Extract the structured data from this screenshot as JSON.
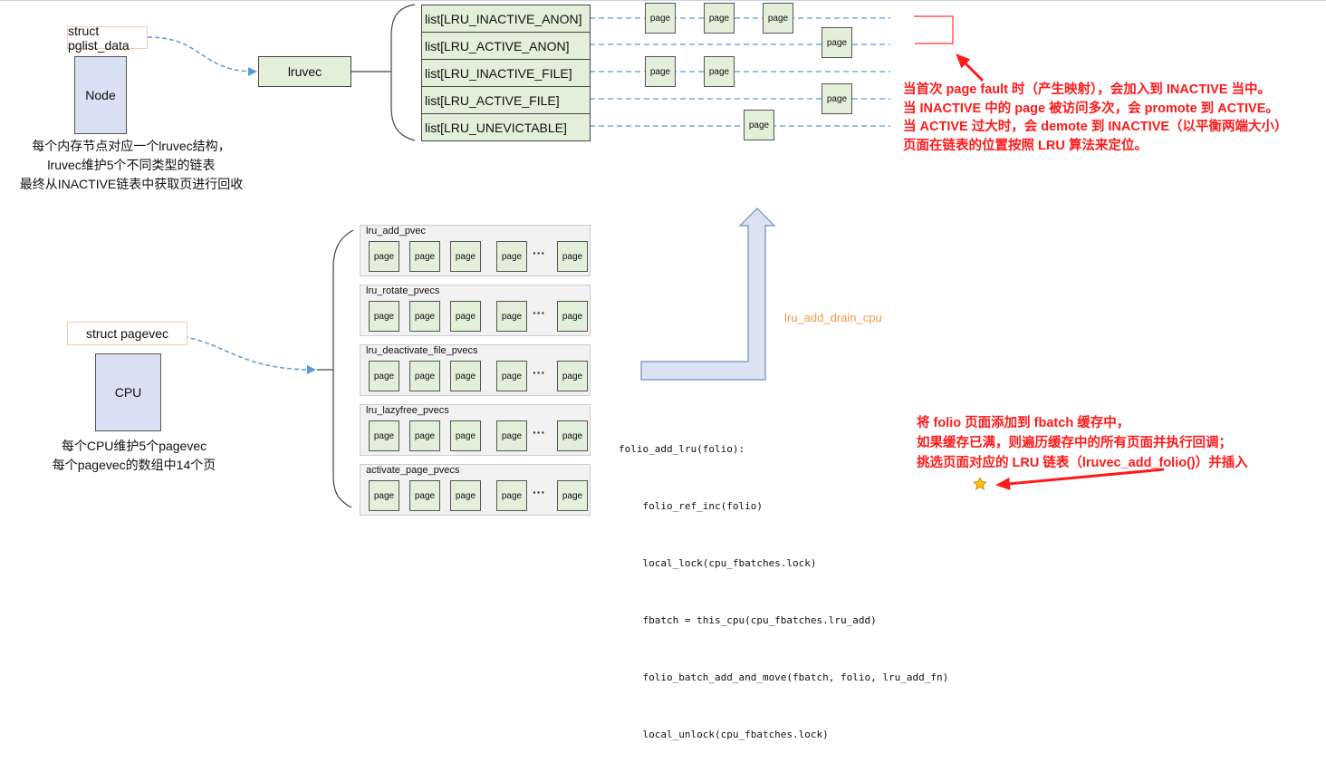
{
  "colors": {
    "struct_border": "#f8cbad",
    "hw_fill": "#dae0f3",
    "list_fill": "#e2efd9",
    "dashed_line": "#5b9bd5",
    "annotation_red": "#ff1a1a",
    "drain_label": "#f79646",
    "arrow_fill": "#dbe3f2"
  },
  "node": {
    "struct_label": "struct pglist_data",
    "box_label": "Node",
    "lruvec_label": "lruvec",
    "caption": [
      "每个内存节点对应一个lruvec结构，",
      "lruvec维护5个不同类型的链表",
      "最终从INACTIVE链表中获取页进行回收"
    ]
  },
  "lists": [
    {
      "label": "list[LRU_INACTIVE_ANON]",
      "pages": [
        "page",
        "page",
        "page"
      ]
    },
    {
      "label": "list[LRU_ACTIVE_ANON]",
      "pages": [
        "page"
      ]
    },
    {
      "label": "list[LRU_INACTIVE_FILE]",
      "pages": [
        "page",
        "page"
      ]
    },
    {
      "label": "list[LRU_ACTIVE_FILE]",
      "pages": [
        "page"
      ]
    },
    {
      "label": "list[LRU_UNEVICTABLE]",
      "pages": [
        "page"
      ]
    }
  ],
  "lru_note": [
    "当首次 page fault 时（产生映射），会加入到 INACTIVE 当中。",
    "当 INACTIVE 中的 page 被访问多次，会 promote 到 ACTIVE。",
    "当 ACTIVE 过大时，会 demote 到 INACTIVE（以平衡两端大小）",
    "页面在链表的位置按照 LRU 算法来定位。"
  ],
  "cpu": {
    "struct_label": "struct pagevec",
    "box_label": "CPU",
    "caption": [
      "每个CPU维护5个pagevec",
      "每个pagevec的数组中14个页"
    ]
  },
  "pagevecs": [
    {
      "name": "lru_add_pvec",
      "pages": [
        "page",
        "page",
        "page",
        "page",
        "page"
      ],
      "ellipsis": "···"
    },
    {
      "name": "lru_rotate_pvecs",
      "pages": [
        "page",
        "page",
        "page",
        "page",
        "page"
      ],
      "ellipsis": "···"
    },
    {
      "name": "lru_deactivate_file_pvecs",
      "pages": [
        "page",
        "page",
        "page",
        "page",
        "page"
      ],
      "ellipsis": "···"
    },
    {
      "name": "lru_lazyfree_pvecs",
      "pages": [
        "page",
        "page",
        "page",
        "page",
        "page"
      ],
      "ellipsis": "···"
    },
    {
      "name": "activate_page_pvecs",
      "pages": [
        "page",
        "page",
        "page",
        "page",
        "page"
      ],
      "ellipsis": "···"
    }
  ],
  "drain_label": "lru_add_drain_cpu",
  "code": [
    "folio_add_lru(folio):",
    "    folio_ref_inc(folio)",
    "    local_lock(cpu_fbatches.lock)",
    "    fbatch = this_cpu(cpu_fbatches.lru_add)",
    "    folio_batch_add_and_move(fbatch, folio, lru_add_fn)",
    "    local_unlock(cpu_fbatches.lock)"
  ],
  "star_icon": "star-icon",
  "fbatch_note": [
    "将 folio 页面添加到 fbatch 缓存中，",
    "如果缓存已满，则遍历缓存中的所有页面并执行回调；",
    "挑选页面对应的 LRU 链表（lruvec_add_folio()）并插入"
  ]
}
